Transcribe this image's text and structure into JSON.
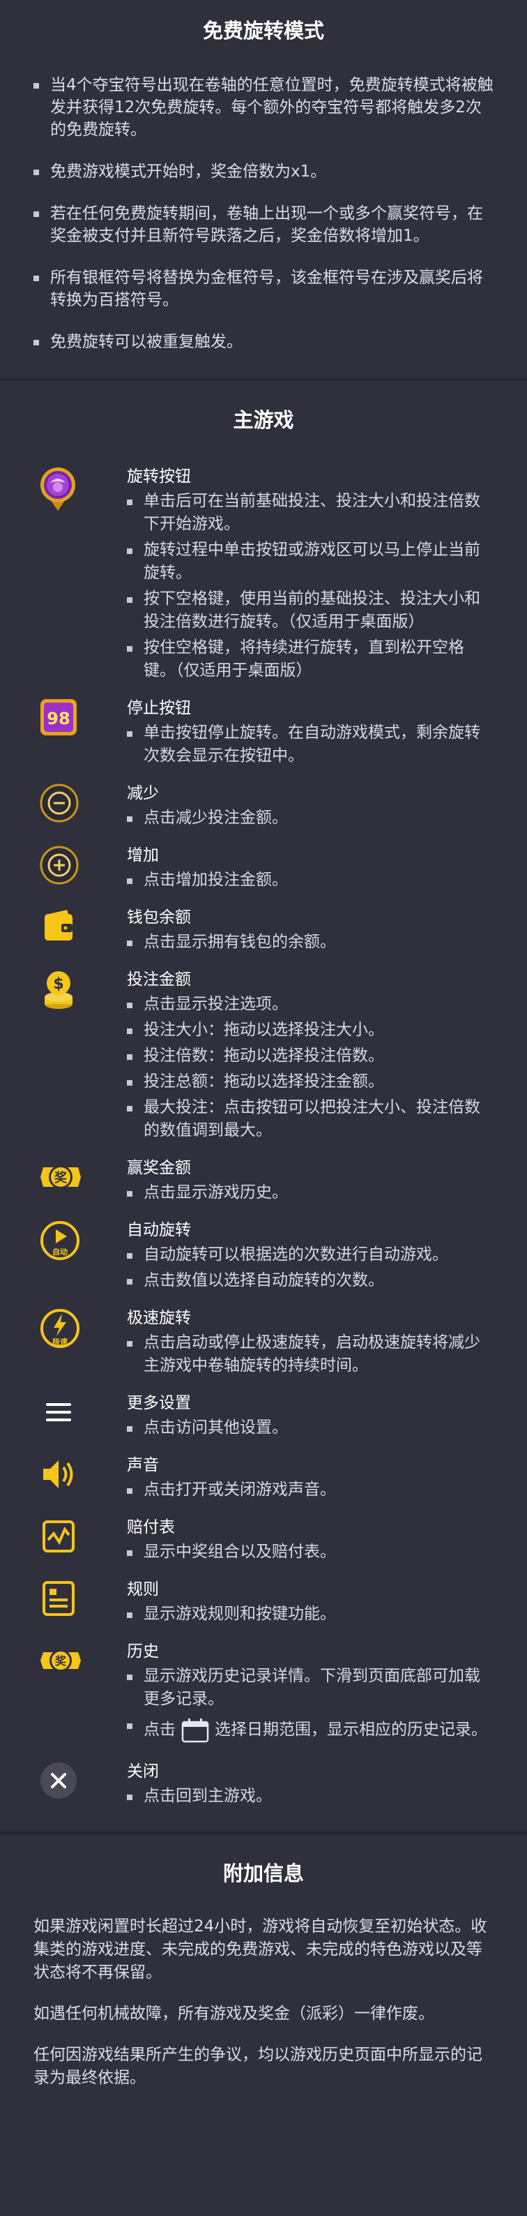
{
  "free_spins": {
    "title": "免费旋转模式",
    "bullets": [
      "当4个夺宝符号出现在卷轴的任意位置时，免费旋转模式将被触发并获得12次免费旋转。每个额外的夺宝符号都将触发多2次的免费旋转。",
      "免费游戏模式开始时，奖金倍数为x1。",
      "若在任何免费旋转期间，卷轴上出现一个或多个赢奖符号，在奖金被支付并且新符号跌落之后，奖金倍数将增加1。",
      "所有银框符号将替换为金框符号，该金框符号在涉及赢奖后将转换为百搭符号。",
      "免费旋转可以被重复触发。"
    ]
  },
  "main_game": {
    "title": "主游戏",
    "items": [
      {
        "icon": "spin-button-icon",
        "title": "旋转按钮",
        "subs": [
          "单击后可在当前基础投注、投注大小和投注倍数下开始游戏。",
          "旋转过程中单击按钮或游戏区可以马上停止当前旋转。",
          "按下空格键，使用当前的基础投注、投注大小和投注倍数进行旋转。（仅适用于桌面版）",
          "按住空格键，将持续进行旋转，直到松开空格键。（仅适用于桌面版）"
        ]
      },
      {
        "icon": "stop-button-icon",
        "icon_text": "98",
        "title": "停止按钮",
        "subs": [
          "单击按钮停止旋转。在自动游戏模式，剩余旋转次数会显示在按钮中。"
        ]
      },
      {
        "icon": "minus-icon",
        "title": "减少",
        "subs": [
          "点击减少投注金额。"
        ]
      },
      {
        "icon": "plus-icon",
        "title": "增加",
        "subs": [
          "点击增加投注金额。"
        ]
      },
      {
        "icon": "wallet-icon",
        "title": "钱包余额",
        "subs": [
          "点击显示拥有钱包的余额。"
        ]
      },
      {
        "icon": "coins-icon",
        "title": "投注金额",
        "subs": [
          "点击显示投注选项。",
          "投注大小：拖动以选择投注大小。",
          "投注倍数：拖动以选择投注倍数。",
          "投注总额：拖动以选择投注金额。",
          "最大投注：点击按钮可以把投注大小、投注倍数的数值调到最大。"
        ]
      },
      {
        "icon": "win-amount-icon",
        "icon_text": "奖",
        "title": "赢奖金额",
        "subs": [
          "点击显示游戏历史。"
        ]
      },
      {
        "icon": "auto-spin-icon",
        "icon_text": "自动",
        "title": "自动旋转",
        "subs": [
          "自动旋转可以根据选的次数进行自动游戏。",
          "点击数值以选择自动旋转的次数。"
        ]
      },
      {
        "icon": "turbo-spin-icon",
        "icon_text": "极速",
        "title": "极速旋转",
        "subs": [
          "点击启动或停止极速旋转，启动极速旋转将减少主游戏中卷轴旋转的持续时间。"
        ]
      },
      {
        "icon": "menu-icon",
        "title": "更多设置",
        "subs": [
          "点击访问其他设置。"
        ]
      },
      {
        "icon": "sound-icon",
        "title": "声音",
        "subs": [
          "点击打开或关闭游戏声音。"
        ]
      },
      {
        "icon": "paytable-icon",
        "title": "赔付表",
        "subs": [
          "显示中奖组合以及赔付表。"
        ]
      },
      {
        "icon": "rules-icon",
        "title": "规则",
        "subs": [
          "显示游戏规则和按键功能。"
        ]
      },
      {
        "icon": "history-icon",
        "icon_text": "奖",
        "title": "历史",
        "subs": [
          "显示游戏历史记录详情。下滑到页面底部可加载更多记录。"
        ],
        "sub_calendar": {
          "before": "点击",
          "icon": "calendar-icon",
          "after": "选择日期范围，显示相应的历史记录。"
        }
      },
      {
        "icon": "close-icon",
        "title": "关闭",
        "subs": [
          "点击回到主游戏。"
        ]
      }
    ]
  },
  "extra_info": {
    "title": "附加信息",
    "paragraphs": [
      "如果游戏闲置时长超过24小时，游戏将自动恢复至初始状态。收集类的游戏进度、未完成的免费游戏、未完成的特色游戏以及等状态将不再保留。",
      "如遇任何机械故障，所有游戏及奖金（派彩）一律作废。",
      "任何因游戏结果所产生的争议，均以游戏历史页面中所显示的记录为最终依据。"
    ]
  },
  "colors": {
    "background": "#30303d",
    "accent_gold": "#f5c518",
    "purple": "#8b2fb8"
  }
}
